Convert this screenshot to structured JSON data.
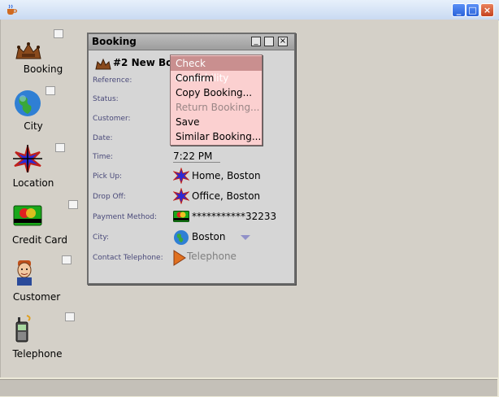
{
  "window": {
    "minimize": "_",
    "maximize": "□",
    "close": "×"
  },
  "desktop_icons": [
    {
      "label": "Booking"
    },
    {
      "label": "City"
    },
    {
      "label": "Location"
    },
    {
      "label": "Credit Card"
    },
    {
      "label": "Customer"
    },
    {
      "label": "Telephone"
    }
  ],
  "booking_window": {
    "title": "Booking",
    "header": "#2 New Booking",
    "fields": [
      {
        "label": "Reference:",
        "value": ""
      },
      {
        "label": "Status:",
        "value": ""
      },
      {
        "label": "Customer:",
        "value": ""
      },
      {
        "label": "Date:",
        "value": ""
      },
      {
        "label": "Time:",
        "value": "7:22 PM"
      },
      {
        "label": "Pick Up:",
        "value": "Home, Boston"
      },
      {
        "label": "Drop Off:",
        "value": "Office, Boston"
      },
      {
        "label": "Payment Method:",
        "value": "***********32233"
      },
      {
        "label": "City:",
        "value": "Boston"
      },
      {
        "label": "Contact Telephone:",
        "value": "Telephone"
      }
    ]
  },
  "context_menu": [
    {
      "label": "Check Availability",
      "state": "selected"
    },
    {
      "label": "Confirm",
      "state": "enabled"
    },
    {
      "label": "Copy Booking...",
      "state": "enabled"
    },
    {
      "label": "Return Booking...",
      "state": "disabled"
    },
    {
      "label": "Save",
      "state": "enabled"
    },
    {
      "label": "Similar Booking...",
      "state": "enabled"
    }
  ],
  "colors": {
    "menu_bg": "#fbd0d0",
    "menu_selected": "#c98f8f"
  }
}
